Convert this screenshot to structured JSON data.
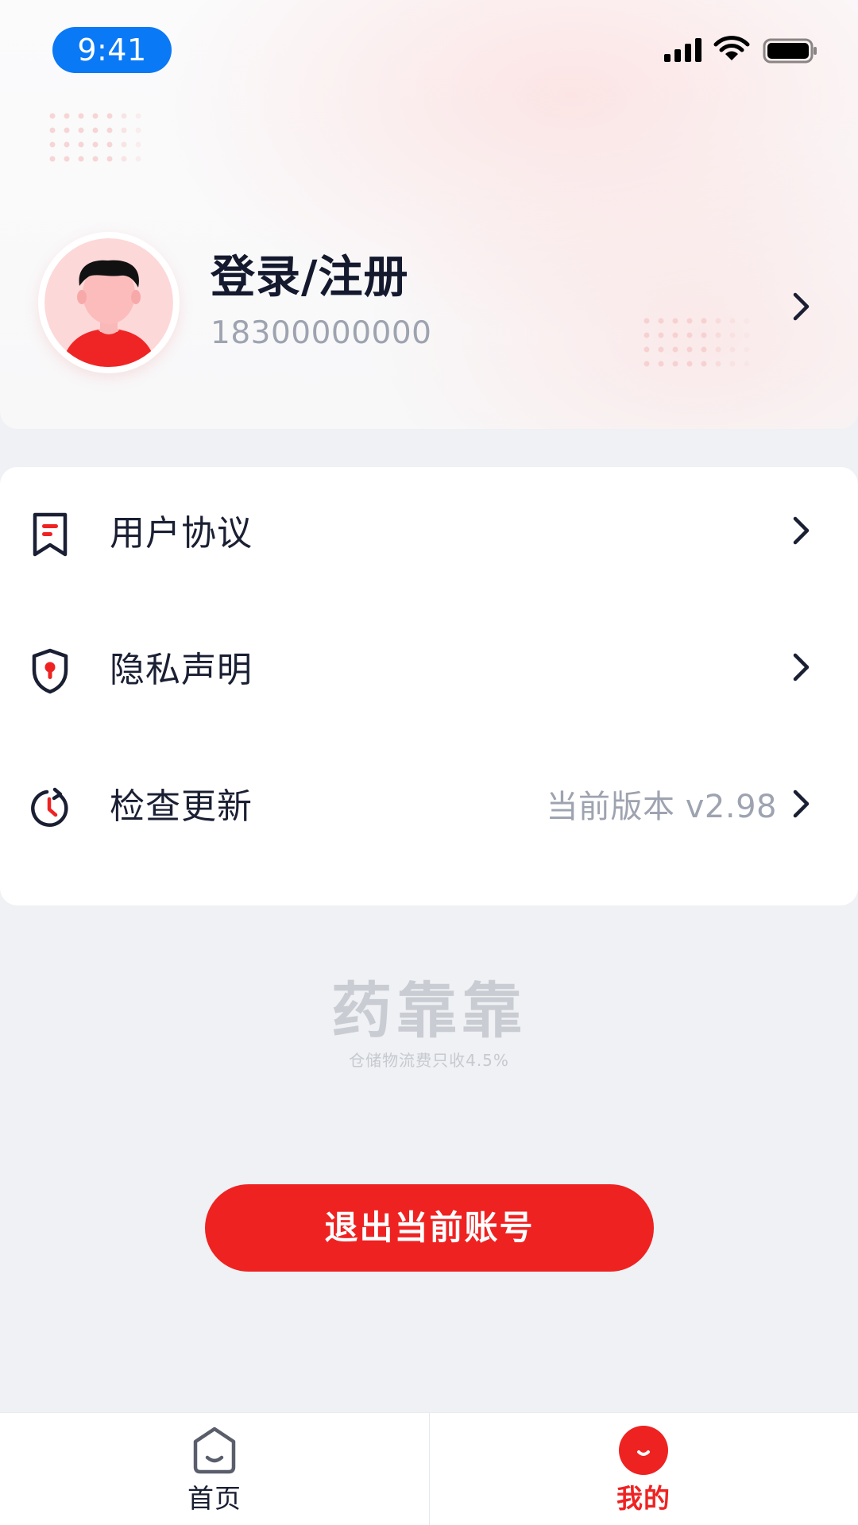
{
  "status_bar": {
    "time": "9:41",
    "icons": [
      "signal-icon",
      "wifi-icon",
      "battery-icon"
    ]
  },
  "profile": {
    "name": "登录/注册",
    "phone": "18300000000",
    "avatar_icon": "user-avatar-icon"
  },
  "menu": {
    "items": [
      {
        "icon": "bookmark-document-icon",
        "label": "用户协议",
        "value": ""
      },
      {
        "icon": "shield-keyhole-icon",
        "label": "隐私声明",
        "value": ""
      },
      {
        "icon": "clock-refresh-icon",
        "label": "检查更新",
        "value": "当前版本 v2.98"
      }
    ]
  },
  "brand": {
    "name": "药靠靠",
    "slogan": "仓储物流费只收4.5%"
  },
  "logout_label": "退出当前账号",
  "tab_bar": {
    "tabs": [
      {
        "icon": "home-icon",
        "label": "首页",
        "active": false
      },
      {
        "icon": "smile-face-icon",
        "label": "我的",
        "active": true
      }
    ]
  },
  "colors": {
    "accent": "#ef2222",
    "time_pill": "#0a79f6",
    "text_primary": "#14192e",
    "text_secondary": "#9ea3b0",
    "background": "#eff1f4"
  }
}
